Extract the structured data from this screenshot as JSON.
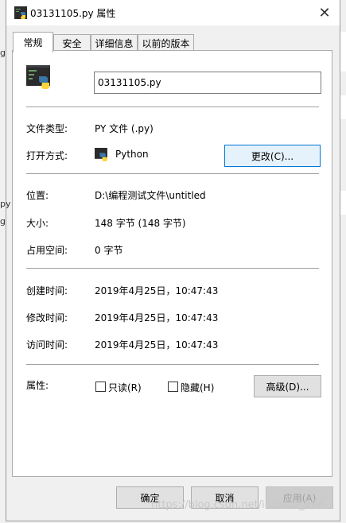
{
  "window": {
    "title": "03131105.py 属性",
    "close_symbol": "✕"
  },
  "background": {
    "side_marks": [
      "g",
      "py",
      "g"
    ]
  },
  "tabs": [
    {
      "label": "常规",
      "active": true
    },
    {
      "label": "安全",
      "active": false
    },
    {
      "label": "详细信息",
      "active": false
    },
    {
      "label": "以前的版本",
      "active": false
    }
  ],
  "general": {
    "filename": "03131105.py",
    "file_type_label": "文件类型:",
    "file_type_value": "PY 文件 (.py)",
    "opens_with_label": "打开方式:",
    "opens_with_value": "Python",
    "change_button": "更改(C)...",
    "location_label": "位置:",
    "location_value": "D:\\编程测试文件\\untitled",
    "size_label": "大小:",
    "size_value": "148 字节 (148 字节)",
    "size_on_disk_label": "占用空间:",
    "size_on_disk_value": "0 字节",
    "created_label": "创建时间:",
    "created_value": "2019年4月25日，10:47:43",
    "modified_label": "修改时间:",
    "modified_value": "2019年4月25日，10:47:43",
    "accessed_label": "访问时间:",
    "accessed_value": "2019年4月25日，10:47:43",
    "attributes_label": "属性:",
    "readonly_label": "只读(R)",
    "readonly_checked": false,
    "hidden_label": "隐藏(H)",
    "hidden_checked": false,
    "advanced_button": "高级(D)..."
  },
  "footer": {
    "ok_button": "确定",
    "cancel_button": "取消",
    "apply_button": "应用(A)",
    "watermark": "https://blog.csdn.net/include_666"
  },
  "colors": {
    "accent": "#0078d7",
    "python_blue": "#3b77a8",
    "python_yellow": "#ffd43b"
  },
  "icons": {
    "title": "python-file-icon",
    "file": "python-file-icon",
    "opens_with": "python-icon",
    "close": "close-icon"
  }
}
